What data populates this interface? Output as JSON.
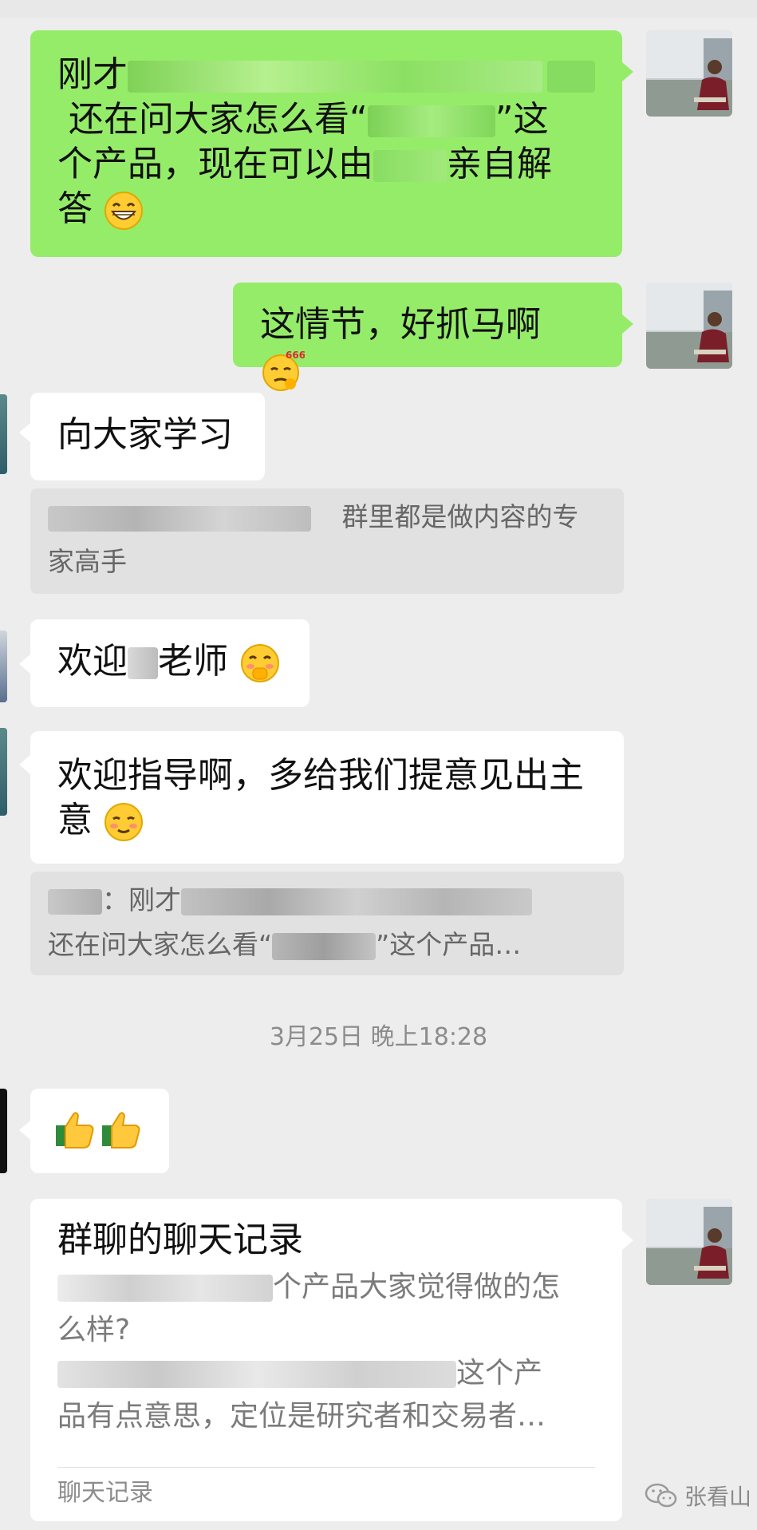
{
  "messages": {
    "m1": {
      "lines": [
        "刚才",
        "还在问大家怎么看“",
        "”这",
        "个产品，现在可以由",
        "亲自解",
        "答"
      ],
      "emoji": "grinning-face"
    },
    "m2": {
      "text": "这情节，好抓马啊",
      "emoji": "666-thinking-face",
      "badge": "666"
    },
    "m3": {
      "text": "向大家学习"
    },
    "m3_quote": {
      "line1": "群里都是做内容的专",
      "line2": "家高手"
    },
    "m4": {
      "prefix": "欢迎",
      "suffix": "老师",
      "emoji": "blushing-face"
    },
    "m5": {
      "line1": "欢迎指导啊，多给我们提意见出主",
      "line2": "意",
      "emoji": "woozy-face"
    },
    "m5_quote": {
      "line1": "：刚才",
      "line2a": "还在问大家怎么看“",
      "line2b": "”这个产品…"
    },
    "timestamp": "3月25日 晚上18:28",
    "m6": {
      "emoji": "thumbs-up-thumbs-up"
    },
    "m7": {
      "title": "群聊的聊天记录",
      "line1": "个产品大家觉得做的怎",
      "line2": "么样?",
      "line3": "这个产",
      "line4": "品有点意思，定位是研究者和交易者…",
      "footer": "聊天记录"
    }
  },
  "watermark": {
    "icon": "wechat-icon",
    "text": "张看山"
  },
  "colors": {
    "background": "#ededed",
    "self_bubble": "#95ec69",
    "other_bubble": "#ffffff",
    "quote": "#e1e1e1"
  }
}
